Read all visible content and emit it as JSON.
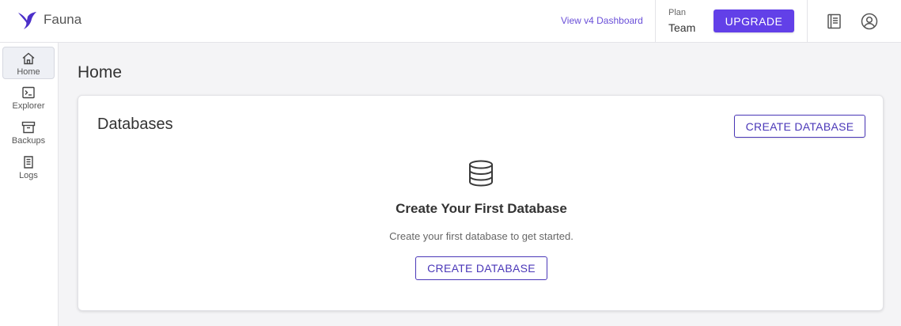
{
  "header": {
    "brand": "Fauna",
    "v4_link": "View v4 Dashboard",
    "plan_label": "Plan",
    "plan_value": "Team",
    "upgrade_label": "UPGRADE",
    "icons": [
      "fauna-logo-icon",
      "docs-book-icon",
      "user-account-icon"
    ]
  },
  "sidebar": {
    "items": [
      {
        "label": "Home",
        "icon": "home-icon",
        "active": true
      },
      {
        "label": "Explorer",
        "icon": "terminal-icon",
        "active": false
      },
      {
        "label": "Backups",
        "icon": "archive-box-icon",
        "active": false
      },
      {
        "label": "Logs",
        "icon": "log-document-icon",
        "active": false
      }
    ]
  },
  "main": {
    "page_title": "Home",
    "card": {
      "title": "Databases",
      "create_button": "CREATE DATABASE",
      "empty_icon": "database-icon",
      "empty_title": "Create Your First Database",
      "empty_subtitle": "Create your first database to get started.",
      "empty_button": "CREATE DATABASE"
    }
  },
  "colors": {
    "accent": "#6240e8",
    "accent_text": "#4a37b8",
    "background": "#f4f4f6"
  }
}
